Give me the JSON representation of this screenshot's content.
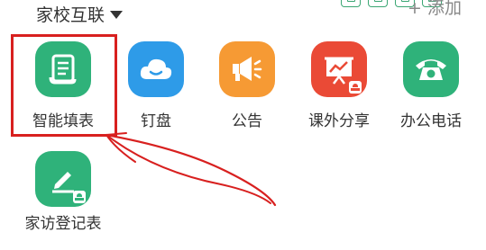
{
  "header": {
    "title": "家校互联",
    "add_label": "+ 添加"
  },
  "colors": {
    "green": "#2fb27a",
    "blue": "#2e9be8",
    "orange": "#f69a34",
    "red": "#ea4a36",
    "annotation_red": "#d8201f"
  },
  "apps": [
    {
      "label": "智能填表",
      "icon": "scroll-form-icon",
      "color": "#2fb27a"
    },
    {
      "label": "钉盘",
      "icon": "cloud-icon",
      "color": "#2e9be8"
    },
    {
      "label": "公告",
      "icon": "megaphone-icon",
      "color": "#f69a34"
    },
    {
      "label": "课外分享",
      "icon": "presentation-chart-icon",
      "color": "#ea4a36"
    },
    {
      "label": "办公电话",
      "icon": "telephone-icon",
      "color": "#2fb27a"
    },
    {
      "label": "家访登记表",
      "icon": "pen-icon",
      "color": "#2fb27a"
    }
  ]
}
